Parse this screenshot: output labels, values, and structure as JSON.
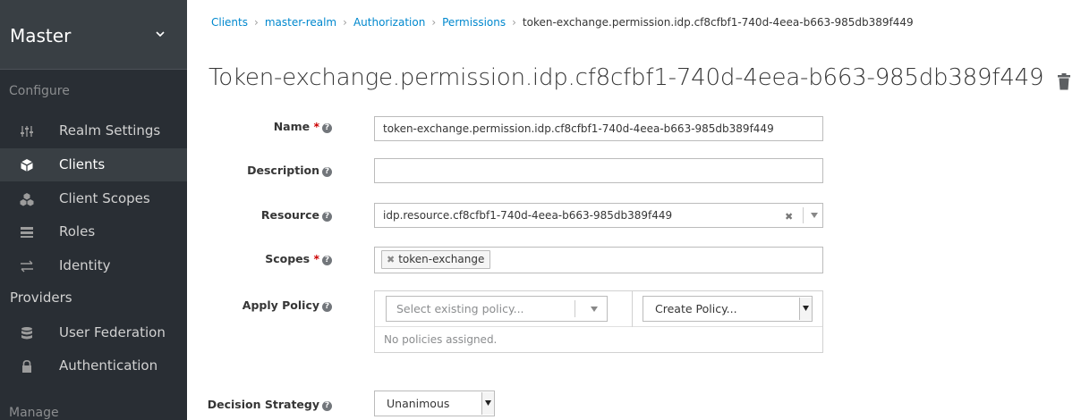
{
  "sidebar": {
    "realm": "Master",
    "configure_label": "Configure",
    "manage_label": "Manage",
    "items": [
      {
        "label": "Realm Settings",
        "icon": "sliders-icon"
      },
      {
        "label": "Clients",
        "icon": "cube-icon",
        "active": true
      },
      {
        "label": "Client Scopes",
        "icon": "cubes-icon"
      },
      {
        "label": "Roles",
        "icon": "roles-icon"
      },
      {
        "label": "Identity",
        "icon": "exchange-icon"
      },
      {
        "label": "Providers"
      },
      {
        "label": "User Federation",
        "icon": "database-icon"
      },
      {
        "label": "Authentication",
        "icon": "lock-icon"
      }
    ]
  },
  "breadcrumb": {
    "items": [
      "Clients",
      "master-realm",
      "Authorization",
      "Permissions",
      "token-exchange.permission.idp.cf8cfbf1-740d-4eea-b663-985db389f449"
    ]
  },
  "page": {
    "title": "Token-exchange.permission.idp.cf8cfbf1-740d-4eea-b663-985db389f449"
  },
  "form": {
    "name_label": "Name",
    "name_value": "token-exchange.permission.idp.cf8cfbf1-740d-4eea-b663-985db389f449",
    "description_label": "Description",
    "description_value": "",
    "resource_label": "Resource",
    "resource_value": "idp.resource.cf8cfbf1-740d-4eea-b663-985db389f449",
    "scopes_label": "Scopes",
    "scopes_tag": "token-exchange",
    "apply_policy_label": "Apply Policy",
    "policy_placeholder": "Select existing policy...",
    "create_policy": "Create Policy...",
    "no_policies": "No policies assigned.",
    "decision_label": "Decision Strategy",
    "decision_value": "Unanimous"
  },
  "colors": {
    "sidebar_bg": "#292e34",
    "link": "#0088ce",
    "required": "#cc0000"
  }
}
